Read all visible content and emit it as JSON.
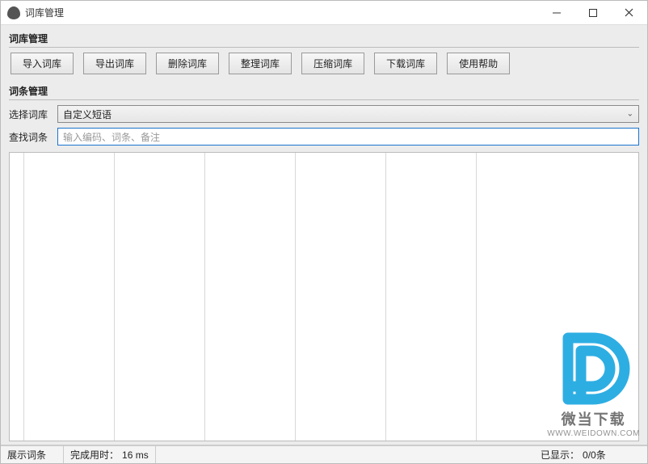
{
  "window": {
    "title": "词库管理"
  },
  "groups": {
    "dict_mgmt": "词库管理",
    "entry_mgmt": "词条管理"
  },
  "toolbar": {
    "import": "导入词库",
    "export": "导出词库",
    "delete": "删除词库",
    "tidy": "整理词库",
    "compress": "压缩词库",
    "download": "下载词库",
    "help": "使用帮助"
  },
  "form": {
    "select_label": "选择词库",
    "select_value": "自定义短语",
    "search_label": "查找词条",
    "search_placeholder": "输入编码、词条、备注"
  },
  "status": {
    "show_entries": "展示词条",
    "elapsed_label": "完成用时：",
    "elapsed_value": "16 ms",
    "displayed_label": "已显示：",
    "displayed_value": "0/0条"
  },
  "watermark": {
    "text": "微当下载",
    "url": "WWW.WEIDOWN.COM"
  }
}
